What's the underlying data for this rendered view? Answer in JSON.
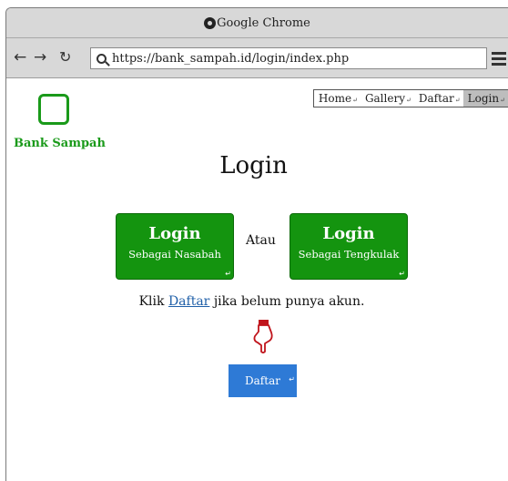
{
  "browser": {
    "app_title": "Google Chrome",
    "url": "https://bank_sampah.id/login/index.php"
  },
  "site": {
    "brand": "Bank Sampah",
    "nav": [
      {
        "label": "Home",
        "active": false
      },
      {
        "label": "Gallery",
        "active": false
      },
      {
        "label": "Daftar",
        "active": false
      },
      {
        "label": "Login",
        "active": true
      }
    ]
  },
  "main": {
    "title": "Login",
    "login_nasabah": {
      "title": "Login",
      "subtitle": "Sebagai Nasabah"
    },
    "separator": "Atau",
    "login_tengkulak": {
      "title": "Login",
      "subtitle": "Sebagai Tengkulak"
    },
    "register_prompt": {
      "before": "Klik ",
      "link": "Daftar",
      "after": " jika belum punya akun."
    },
    "daftar_button": "Daftar"
  },
  "colors": {
    "primary_green": "#14940f",
    "brand_green": "#1a9a1a",
    "daftar_blue": "#2e7ad6",
    "active_nav": "#bdbdbd"
  }
}
